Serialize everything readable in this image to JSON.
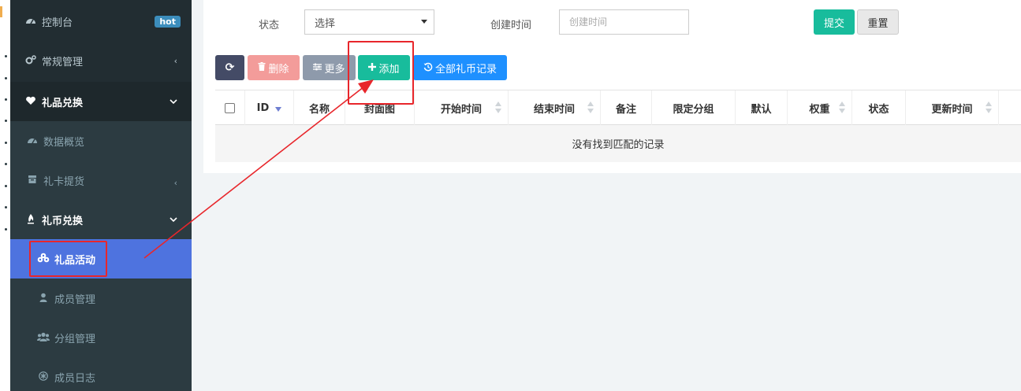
{
  "sidebar": {
    "items": [
      {
        "label": "控制台",
        "icon": "dashboard-icon",
        "badge": "hot",
        "arrow": ""
      },
      {
        "label": "常规管理",
        "icon": "cogs-icon",
        "arrow": "‹"
      },
      {
        "label": "礼品兑换",
        "icon": "heart-icon",
        "arrow": "⌄"
      },
      {
        "label": "数据概览",
        "icon": "dashboard-icon",
        "arrow": ""
      },
      {
        "label": "礼卡提货",
        "icon": "archive-icon",
        "arrow": "‹"
      },
      {
        "label": "礼币兑换",
        "icon": "fire-icon",
        "arrow": "⌄"
      },
      {
        "label": "礼品活动",
        "icon": "cubes-icon",
        "arrow": ""
      },
      {
        "label": "成员管理",
        "icon": "user-icon",
        "arrow": ""
      },
      {
        "label": "分组管理",
        "icon": "users-icon",
        "arrow": ""
      },
      {
        "label": "成员日志",
        "icon": "asterisk-icon",
        "arrow": ""
      }
    ]
  },
  "filter": {
    "status_label": "状态",
    "status_value": "选择",
    "created_label": "创建时间",
    "created_placeholder": "创建时间",
    "submit_label": "提交",
    "reset_label": "重置"
  },
  "toolbar": {
    "refresh_icon": "⟳",
    "delete_label": "删除",
    "more_label": "更多",
    "add_label": "添加",
    "records_label": "全部礼币记录"
  },
  "table": {
    "columns": [
      "ID",
      "名称",
      "封面图",
      "开始时间",
      "结束时间",
      "备注",
      "限定分组",
      "默认",
      "权重",
      "状态",
      "更新时间"
    ],
    "empty_text": "没有找到匹配的记录"
  },
  "colors": {
    "sidebar_bg": "#222d32",
    "active_item": "#4e73df",
    "add_button": "#18bc9c",
    "delete_button": "#f39c9a",
    "more_button": "#8e9aab",
    "records_button": "#1e90ff",
    "refresh_button": "#444b66",
    "annotation": "#e8262b"
  }
}
